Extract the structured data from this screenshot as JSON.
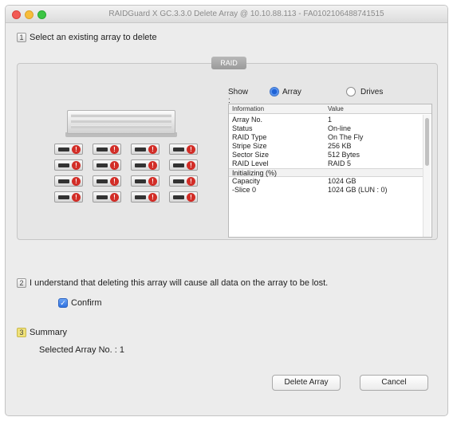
{
  "window": {
    "title": "RAIDGuard X GC.3.3.0 Delete Array @ 10.10.88.113 - FA0102106488741515"
  },
  "step1": {
    "number": "1",
    "text": "Select an existing array to delete"
  },
  "raid_group": {
    "tab_label": "RAID",
    "show_label": "Show :",
    "radio_array_label": "Array",
    "radio_drives_label": "Drives",
    "selected_view": "Array",
    "disk_status_icon": "error-icon",
    "disk_status_color": "#d22d27",
    "table": {
      "headers": [
        "Information",
        "Value"
      ],
      "rows": [
        {
          "name": "Array No.",
          "value": "1"
        },
        {
          "name": "Status",
          "value": "On-line"
        },
        {
          "name": "RAID Type",
          "value": "On The Fly"
        },
        {
          "name": "Stripe Size",
          "value": "256 KB"
        },
        {
          "name": "Sector Size",
          "value": "512 Bytes"
        },
        {
          "name": "RAID Level",
          "value": "RAID 5"
        },
        {
          "name": "Initializing (%)",
          "value": ""
        },
        {
          "name": "Capacity",
          "value": "1024 GB"
        },
        {
          "name": "-Slice 0",
          "value": "1024 GB (LUN : 0)"
        }
      ]
    }
  },
  "step2": {
    "number": "2",
    "text": "I understand that deleting this array will cause all data on the array to be lost.",
    "confirm_label": "Confirm",
    "confirm_checked": true
  },
  "step3": {
    "number": "3",
    "title": "Summary",
    "selected_array": "Selected Array No. : 1"
  },
  "buttons": {
    "delete": "Delete Array",
    "cancel": "Cancel"
  },
  "colors": {
    "accent": "#2f72e0",
    "error": "#d22d27"
  }
}
